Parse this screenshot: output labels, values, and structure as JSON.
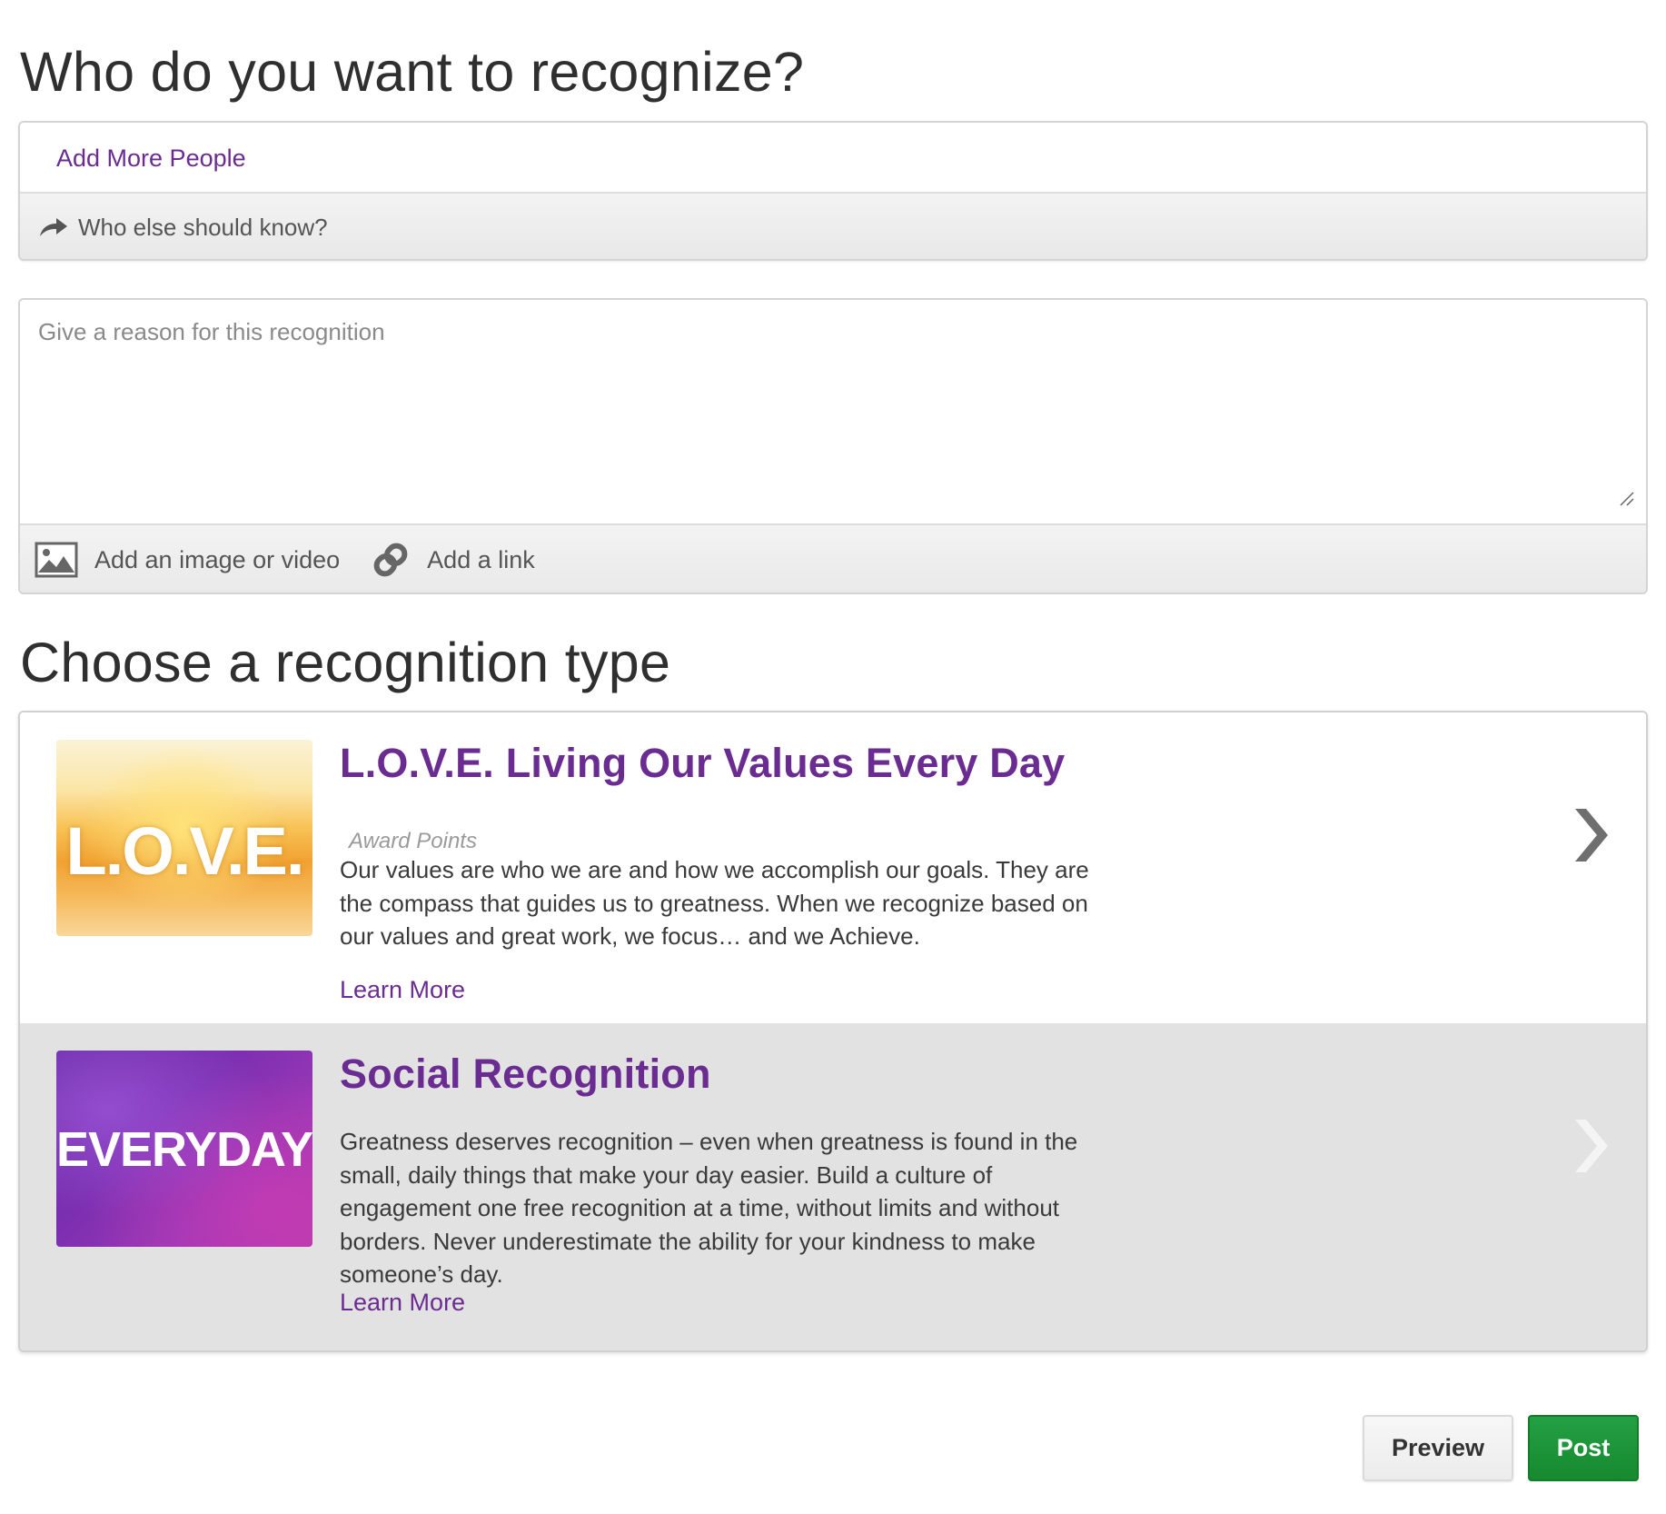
{
  "heading_recipients": "Who do you want to recognize?",
  "recipients": {
    "add_more_people": "Add More People",
    "notify_label": "Who else should know?"
  },
  "reason": {
    "placeholder": "Give a reason for this recognition"
  },
  "attachments": {
    "image_video_label": "Add an image or video",
    "link_label": "Add a link"
  },
  "heading_types": "Choose a recognition type",
  "recognition_types": [
    {
      "thumb_text": "L.O.V.E.",
      "title": "L.O.V.E. Living Our Values Every Day",
      "subtitle": "Award Points",
      "description": "Our values are who we are and how we accomplish our goals. They are the compass that guides us to greatness. When we recognize based on our values and great work, we focus… and we Achieve.",
      "learn_more": "Learn More"
    },
    {
      "thumb_text": "EVERYDAY",
      "title": "Social Recognition",
      "description": "Greatness deserves recognition – even when greatness is found in the small, daily things that make your day easier. Build a culture of engagement one free recognition at a time, without limits and without borders. Never underestimate the ability for your kindness to make someone’s day.",
      "learn_more": "Learn More"
    }
  ],
  "actions": {
    "preview_label": "Preview",
    "post_label": "Post"
  },
  "colors": {
    "brand_purple": "#6b2c91",
    "post_green": "#1e9a3c",
    "selected_row_bg": "#e2e2e2"
  },
  "icons": [
    "share-arrow-icon",
    "image-icon",
    "link-icon",
    "chevron-right-icon",
    "resize-grip-icon"
  ]
}
